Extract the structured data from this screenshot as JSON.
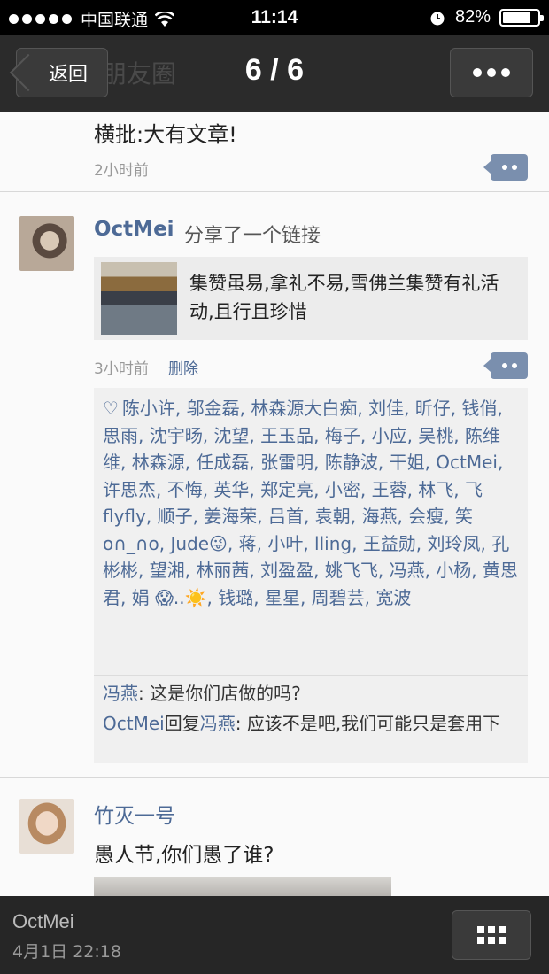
{
  "status_bar": {
    "carrier": "中国联通",
    "time": "11:14",
    "battery": "82%",
    "battery_level": 0.82
  },
  "nav": {
    "back_label": "返回",
    "background_title": "朋友圈",
    "page_indicator": "6 / 6",
    "icons": {
      "back": "chevron-left-icon",
      "more": "more-dots-icon"
    }
  },
  "prev_post": {
    "text": "横批:大有文章!",
    "time": "2小时前"
  },
  "post": {
    "author": "OctMei",
    "action": "分享了一个链接",
    "link_title": "集赞虽易,拿礼不易,雪佛兰集赞有礼活动,且行且珍惜",
    "time": "3小时前",
    "delete_label": "删除",
    "likes_text": "陈小许, 邬金磊, 林森源大白痴, 刘佳, 昕仔, 钱俏, 思雨, 沈宇旸, 沈望, 王玉品, 梅子, 小应, 吴桃, 陈维维, 林森源, 任成磊, 张雷明, 陈静波, 干姐, OctMei, 许思杰, 不悔, 英华, 郑定亮, 小密, 王蓉, 林飞, 飞flyfly, 顺子, 姜海荣, 吕首, 袁朝, 海燕, 会瘦, 笑 o∩_∩o, Jude😜, 蒋, 小叶, lling, 王益勋, 刘玲凤, 孔彬彬, 望湘, 林丽茜, 刘盈盈, 姚飞飞, 冯燕, 小杨, 黄思君, 娟 😱..☀️, 钱璐, 星星, 周碧芸, 宽波",
    "comments": [
      {
        "name": "冯燕",
        "sep": ": ",
        "text": "这是你们店做的吗?"
      },
      {
        "name": "OctMei",
        "reply_word": "回复",
        "reply_to": "冯燕",
        "sep": ": ",
        "text": "应该不是吧,我们可能只是套用下"
      }
    ]
  },
  "next_post": {
    "author": "竹灭一号",
    "text": "愚人节,你们愚了谁?"
  },
  "bottom_bar": {
    "name": "OctMei",
    "datetime": "4月1日 22:18",
    "grid_icon": "grid-icon"
  }
}
